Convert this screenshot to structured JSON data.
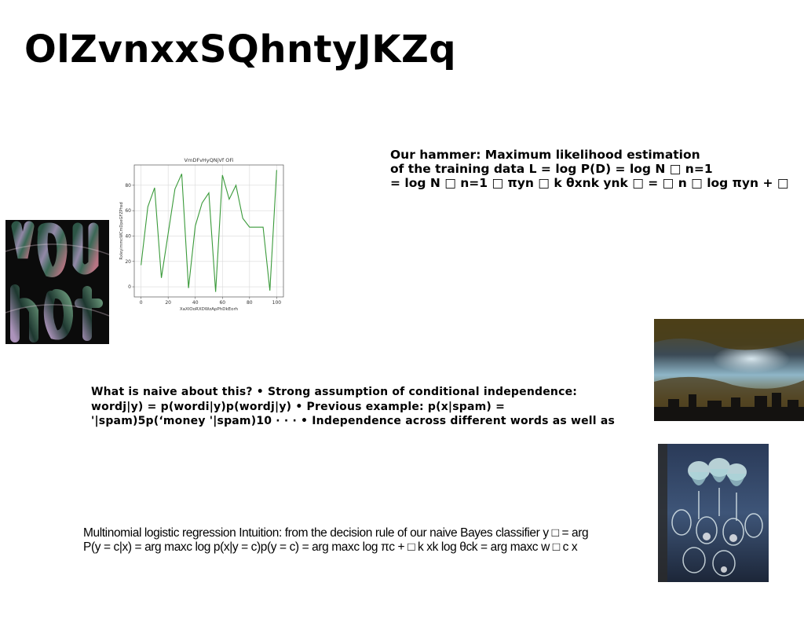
{
  "slide": {
    "title": "OlZvnxxSQhntyJKZq",
    "para_a": [
      "Our hammer: Maximum likelihood estimation",
      "of the training data L = log P(D) = log N □ n=1",
      "= log N □ n=1 □ πyn □ k θxnk ynk □ = □ n □ log πyn + □"
    ],
    "para_b": [
      "What is naive about this? • Strong assumption of conditional independence:",
      "wordj|y) = p(wordi|y)p(wordj|y) • Previous example: p(x|spam) =",
      "'|spam)5p(‘money '|spam)10 · · · • Independence across different words as well as"
    ],
    "para_c": [
      "Multinomial logistic regression Intuition: from the decision rule of our naive Bayes classifier y □ = arg",
      "P(y = c|x) = arg maxc log p(x|y = c)p(y = c) = arg maxc log πc + □ k xk log θck = arg maxc w □ c x"
    ]
  },
  "images": {
    "you_art": "abstract-lettering-image",
    "cloudy_sky": "city-sky-photo",
    "glasses": "wine-glasses-photo"
  },
  "chart_data": {
    "type": "line",
    "title": "VmDFvHyQNjVf OFi",
    "xlabel": "XaXlOoRXDWzApPhDkEorh",
    "ylabel": "RxleyimmcWCmDpeGFZPhsd",
    "x": [
      0,
      5,
      10,
      15,
      20,
      25,
      30,
      35,
      40,
      45,
      50,
      55,
      60,
      65,
      70,
      75,
      80,
      85,
      90,
      95,
      100
    ],
    "series": [
      {
        "values": [
          17,
          63,
          78,
          7,
          42,
          77,
          89,
          -1,
          48,
          66,
          74,
          -4,
          88,
          69,
          80,
          54,
          47,
          47,
          47,
          -3,
          92
        ]
      }
    ],
    "xlim": [
      -5,
      105
    ],
    "ylim": [
      -8,
      96
    ],
    "xticks": [
      0,
      20,
      40,
      60,
      80,
      100
    ],
    "yticks": [
      0,
      20,
      40,
      60,
      80
    ],
    "grid": true,
    "colors": {
      "line": "#3a9a3a",
      "grid": "#d9d9d9",
      "axis": "#555555"
    }
  }
}
